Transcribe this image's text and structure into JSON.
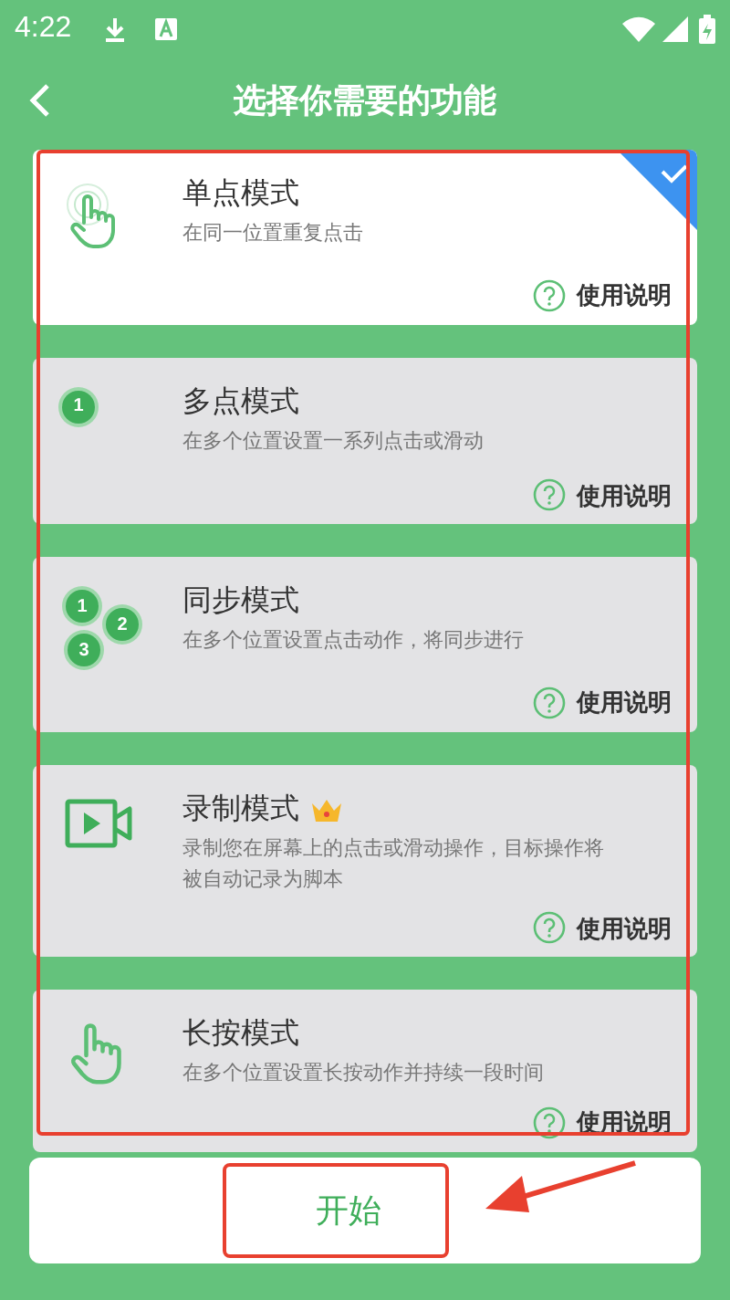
{
  "status_bar": {
    "time": "4:22"
  },
  "header": {
    "title": "选择你需要的功能"
  },
  "modes": [
    {
      "kind": "tap",
      "title": "单点模式",
      "description": "在同一位置重复点击",
      "help": "使用说明",
      "selected": true,
      "premium": false
    },
    {
      "kind": "multi",
      "title": "多点模式",
      "description": "在多个位置设置一系列点击或滑动",
      "help": "使用说明",
      "selected": false,
      "premium": false,
      "markers": [
        "1"
      ]
    },
    {
      "kind": "sync",
      "title": "同步模式",
      "description": "在多个位置设置点击动作，将同步进行",
      "help": "使用说明",
      "selected": false,
      "premium": false,
      "markers": [
        "1",
        "2",
        "3"
      ]
    },
    {
      "kind": "record",
      "title": "录制模式",
      "description": "录制您在屏幕上的点击或滑动操作，目标操作将被自动记录为脚本",
      "help": "使用说明",
      "selected": false,
      "premium": true
    },
    {
      "kind": "press",
      "title": "长按模式",
      "description": "在多个位置设置长按动作并持续一段时间",
      "help": "使用说明",
      "selected": false,
      "premium": false
    }
  ],
  "start_button": {
    "label": "开始"
  },
  "annotations": {
    "list_frame": true,
    "button_frame": true,
    "arrow": true
  }
}
